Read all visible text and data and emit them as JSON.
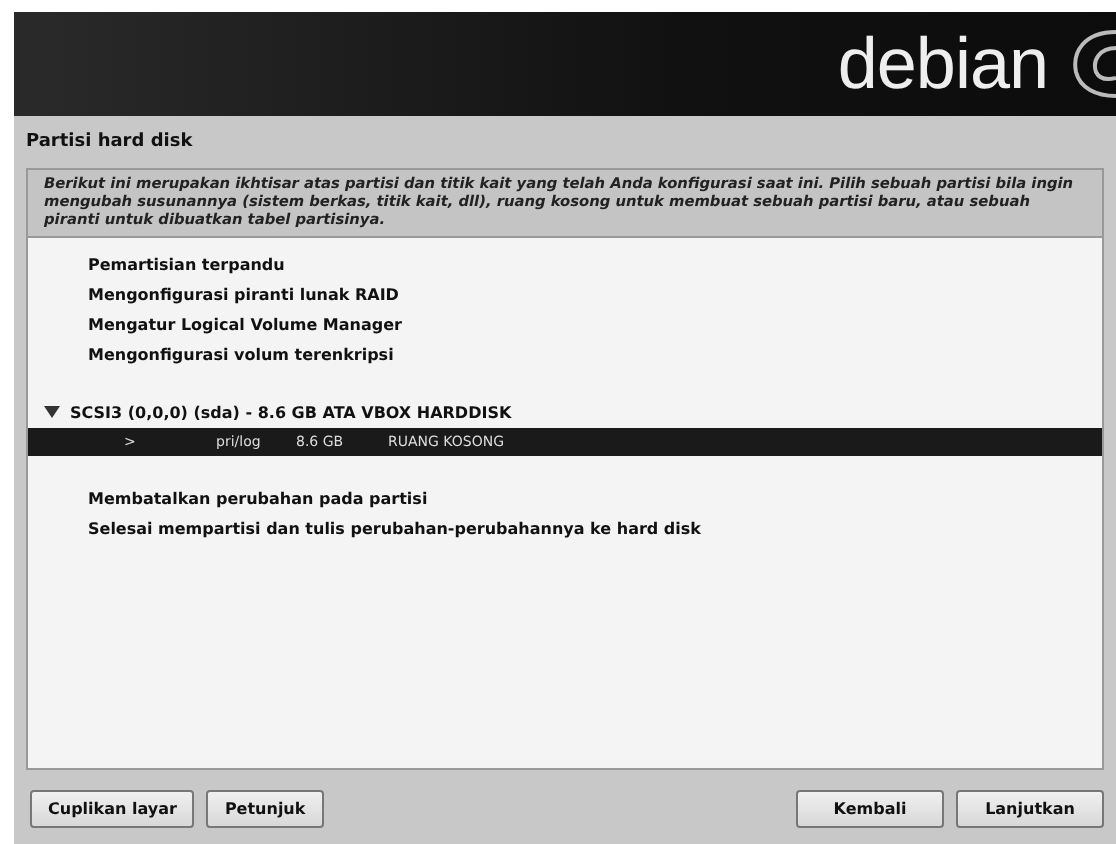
{
  "header": {
    "logo_text": "debian"
  },
  "page_title": "Partisi hard disk",
  "description": "Berikut ini merupakan ikhtisar atas partisi dan titik kait yang telah Anda konfigurasi saat ini. Pilih sebuah partisi bila ingin mengubah susunannya (sistem berkas, titik kait, dll), ruang kosong untuk membuat sebuah partisi baru, atau sebuah piranti untuk dibuatkan tabel partisinya.",
  "list": [
    {
      "kind": "action",
      "label": "Pemartisian terpandu",
      "selected": false
    },
    {
      "kind": "action",
      "label": "Mengonfigurasi piranti lunak RAID",
      "selected": false
    },
    {
      "kind": "action",
      "label": "Mengatur Logical Volume Manager",
      "selected": false
    },
    {
      "kind": "action",
      "label": "Mengonfigurasi volum terenkripsi",
      "selected": false
    },
    {
      "kind": "gap"
    },
    {
      "kind": "disk",
      "label": "SCSI3 (0,0,0) (sda) - 8.6 GB ATA VBOX HARDDISK",
      "expanded": true,
      "selected": false,
      "children": [
        {
          "kind": "partition",
          "marker": ">",
          "type": "pri/log",
          "size": "8.6 GB",
          "usage": "RUANG KOSONG",
          "selected": true
        }
      ]
    },
    {
      "kind": "gap"
    },
    {
      "kind": "action",
      "label": "Membatalkan perubahan pada partisi",
      "selected": false
    },
    {
      "kind": "action",
      "label": "Selesai mempartisi dan tulis perubahan-perubahannya ke hard disk",
      "selected": false
    }
  ],
  "buttons_left": [
    "Cuplikan layar",
    "Petunjuk"
  ],
  "buttons_right": [
    "Kembali",
    "Lanjutkan"
  ]
}
